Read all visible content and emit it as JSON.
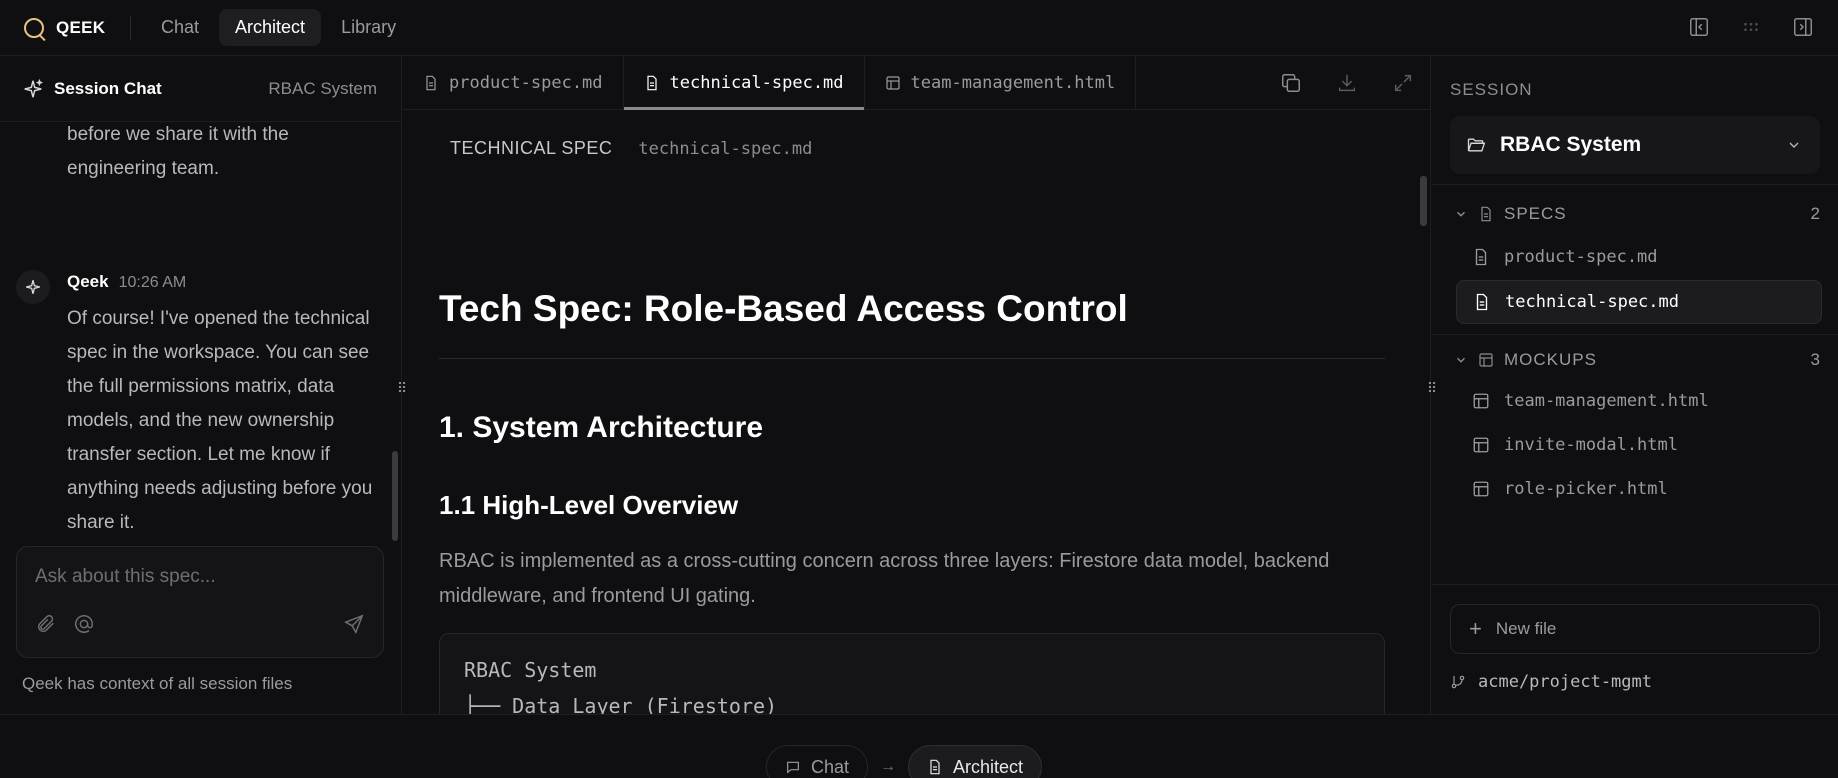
{
  "app": {
    "name": "QEEK",
    "nav_tabs": [
      "Chat",
      "Architect",
      "Library"
    ],
    "active_tab": "Architect"
  },
  "chat": {
    "title": "Session Chat",
    "context": "RBAC System",
    "prev_message": "before we share it with the engineering team.",
    "message": {
      "author": "Qeek",
      "time": "10:26 AM",
      "body": "Of course! I've opened the technical spec in the workspace. You can see the full permissions matrix, data models, and the new ownership transfer section. Let me know if anything needs adjusting before you share it."
    },
    "input_placeholder": "Ask about this spec...",
    "footer": "Qeek has context of all session files"
  },
  "editor": {
    "tabs": [
      {
        "label": "product-spec.md",
        "icon": "file-icon"
      },
      {
        "label": "technical-spec.md",
        "icon": "file-icon"
      },
      {
        "label": "team-management.html",
        "icon": "layout-icon"
      }
    ],
    "active_tab": "technical-spec.md",
    "doc_kind": "TECHNICAL SPEC",
    "doc_file": "technical-spec.md",
    "h1": "Tech Spec: Role-Based Access Control",
    "h2": "1. System Architecture",
    "h3": "1.1 High-Level Overview",
    "paragraph": "RBAC is implemented as a cross-cutting concern across three layers: Firestore data model, backend middleware, and frontend UI gating.",
    "code": "RBAC System\n├── Data Layer (Firestore)\n│   ├── teams/{teamId}/members/{userId}\n│   │"
  },
  "session": {
    "label": "SESSION",
    "name": "RBAC System",
    "groups": [
      {
        "label": "SPECS",
        "count": "2",
        "icon": "file-icon",
        "items": [
          "product-spec.md",
          "technical-spec.md"
        ]
      },
      {
        "label": "MOCKUPS",
        "count": "3",
        "icon": "layout-icon",
        "items": [
          "team-management.html",
          "invite-modal.html",
          "role-picker.html"
        ]
      }
    ],
    "active_file": "technical-spec.md",
    "new_file": "New file",
    "repo": "acme/project-mgmt"
  },
  "modes": {
    "chat": "Chat",
    "architect": "Architect",
    "active": "Architect"
  },
  "colors": {
    "background": "#0f0f11",
    "brand_accent": "#e8c280"
  }
}
